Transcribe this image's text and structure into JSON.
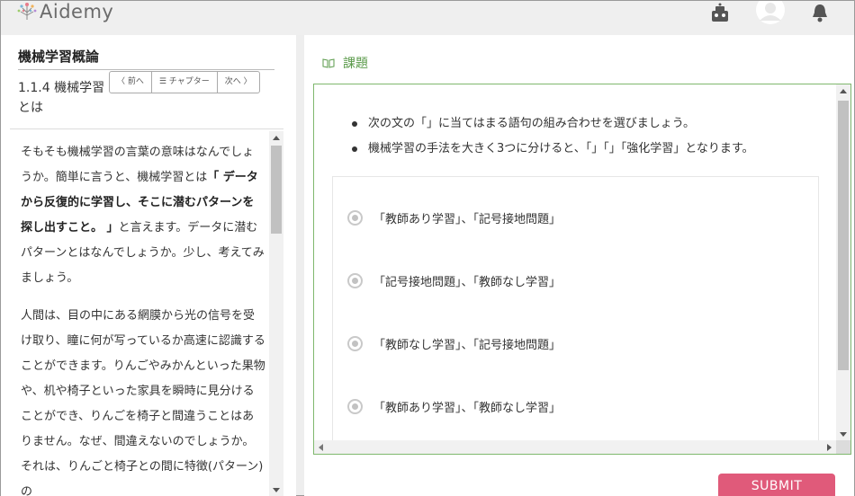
{
  "header": {
    "logo_text": "Aidemy",
    "icons": [
      "robot-icon",
      "avatar",
      "bell-icon"
    ]
  },
  "left": {
    "chapter_title": "機械学習概論",
    "section_title": "1.1.4 機械学習とは",
    "nav": {
      "prev": "〈 前へ",
      "chapter": "☰ チャプター",
      "next": "次へ 〉"
    },
    "paragraphs": {
      "p1_a": "そもそも機械学習の言葉の意味はなんでしょうか。簡単に言うと、機械学習とは",
      "p1_b": "「 データから反復的に学習し、そこに潜むパターンを探し出すこと。 」",
      "p1_c": "と言えます。データに潜むパターンとはなんでしょうか。少し、考えてみましょう。",
      "p2": "人間は、目の中にある網膜から光の信号を受け取り、瞳に何が写っているか高速に認識することができます。りんごやみかんといった果物や、机や椅子といった家具を瞬時に見分けることができ、りんごを椅子と間違うことはありません。なぜ、間違えないのでしょうか。それは、りんごと椅子との間に特徴(パターン)の"
    }
  },
  "right": {
    "task_label": "課題",
    "instructions": [
      "次の文の「」に当てはまる語句の組み合わせを選びましょう。",
      "機械学習の手法を大きく3つに分けると、「」「」「強化学習」となります。"
    ],
    "options": [
      "「教師あり学習」、「記号接地問題」",
      "「記号接地問題」、「教師なし学習」",
      "「教師なし学習」、「記号接地問題」",
      "「教師あり学習」、「教師なし学習」"
    ],
    "submit_label": "SUBMIT"
  },
  "colors": {
    "accent_green": "#5a9a4a",
    "submit_pink": "#e05a7a"
  }
}
